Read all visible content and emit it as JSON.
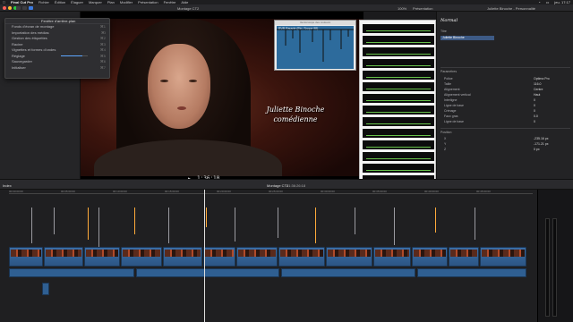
{
  "menubar": {
    "apple": "",
    "app": "Final Cut Pro",
    "items": [
      "Fichier",
      "Édition",
      "Élaguer",
      "Marquer",
      "Plan",
      "Modifier",
      "Présentation",
      "Fenêtre",
      "Aide"
    ],
    "clock": "jeu. 17:17"
  },
  "toolbar": {
    "title": "Montage CT2",
    "zoom": "100%",
    "presentation": "Présentation",
    "inspector_title": "Juliette Binoche - Personnalité"
  },
  "dropdown": {
    "header": "Fenêtre d'arrière-plan",
    "items": [
      {
        "label": "Fonds d'écran de montage",
        "shortcut": "⌘1"
      },
      {
        "label": "Importation des médias",
        "shortcut": "⌘I"
      },
      {
        "label": "Gestion des étiquettes",
        "shortcut": "⌘2"
      },
      {
        "label": "Racine",
        "shortcut": "⌘3"
      },
      {
        "label": "Vignettes et formes d'ondes",
        "shortcut": "⌘4"
      },
      {
        "label": "Réglage",
        "shortcut": "⌘5"
      },
      {
        "label": "Sauvegarder",
        "shortcut": "⌘6"
      },
      {
        "label": "Initialiser",
        "shortcut": "⌘7"
      }
    ]
  },
  "viewer": {
    "caption_line1": "Juliette Binoche",
    "caption_line2": "comédienne",
    "timecode": "1:36:10"
  },
  "scopes": {
    "title": "Vectorscope des couleurs",
    "blue_label": "RVB Parade (Fin. Scope 98)"
  },
  "inspector": {
    "title": "Normal",
    "section1": "Titre",
    "highlight": "Juliette Binoche",
    "section2": "Paramètres",
    "rows": [
      {
        "label": "Police",
        "value": "Optima Pro"
      },
      {
        "label": "Taille",
        "value": "116.0"
      },
      {
        "label": "Alignement",
        "value": "Centre"
      },
      {
        "label": "Alignement vertical",
        "value": "Haut"
      },
      {
        "label": "Interligne",
        "value": "0"
      },
      {
        "label": "Ligne de base",
        "value": "0"
      },
      {
        "label": "Crénage",
        "value": "0"
      },
      {
        "label": "Faux gras",
        "value": "0.0"
      },
      {
        "label": "Ligne de base",
        "value": "0"
      }
    ],
    "section3": "Position",
    "pos_rows": [
      {
        "label": "X",
        "value": "-235.16 px"
      },
      {
        "label": "Y",
        "value": "-171.21 px"
      },
      {
        "label": "Z",
        "value": "0 px"
      }
    ]
  },
  "timeline": {
    "index": "Index",
    "project": "Montage CT2",
    "timecode": "01:36:26:18",
    "ruler": [
      "00:00:00:00",
      "00:05:00:00",
      "00:10:00:00",
      "00:15:00:00",
      "00:20:00:00",
      "00:25:00:00",
      "00:30:00:00",
      "00:35:00:00",
      "00:40:00:00",
      "00:45:00:00"
    ]
  },
  "colors": {
    "accent": "#5da6ff",
    "clip_blue": "#3b6ea6",
    "marker_orange": "#ffaa3a",
    "waveform_green": "#67c24a"
  }
}
